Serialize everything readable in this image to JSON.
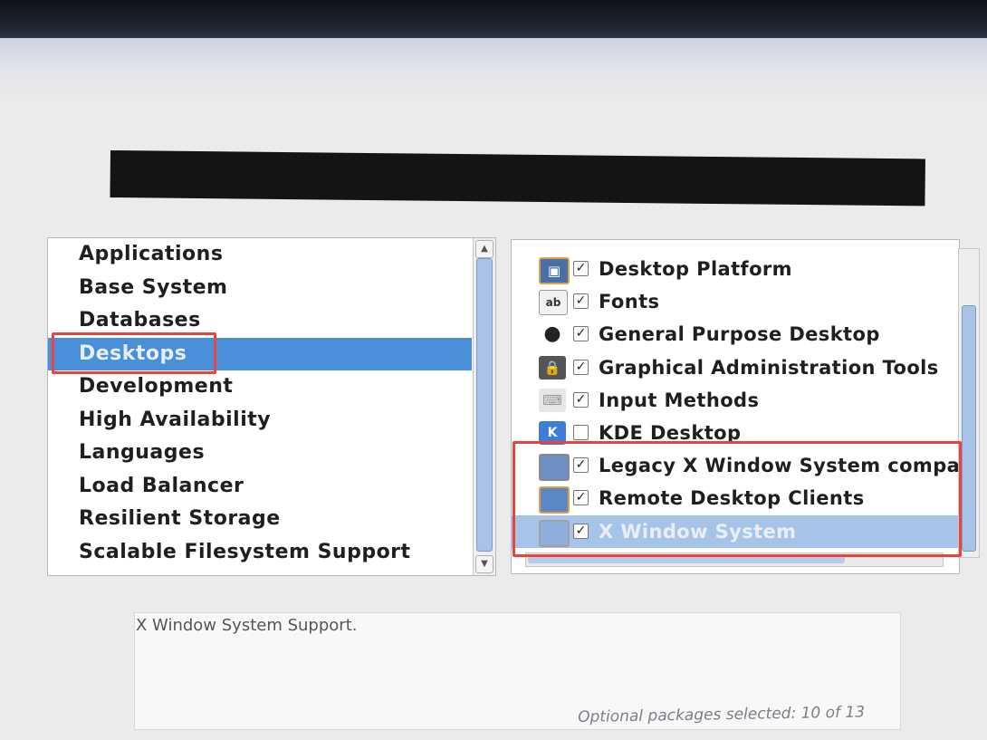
{
  "categories": [
    {
      "label": "Applications"
    },
    {
      "label": "Base System"
    },
    {
      "label": "Databases"
    },
    {
      "label": "Desktops"
    },
    {
      "label": "Development"
    },
    {
      "label": "High Availability"
    },
    {
      "label": "Languages"
    },
    {
      "label": "Load Balancer"
    },
    {
      "label": "Resilient Storage"
    },
    {
      "label": "Scalable Filesystem Support"
    }
  ],
  "selected_category": "Desktops",
  "packages": [
    {
      "label": "Desktop Platform",
      "checked": true,
      "icon": "desktop-platform-icon"
    },
    {
      "label": "Fonts",
      "checked": true,
      "icon": "fonts-icon"
    },
    {
      "label": "General Purpose Desktop",
      "checked": true,
      "icon": "gnome-foot-icon"
    },
    {
      "label": "Graphical Administration Tools",
      "checked": true,
      "icon": "admin-lock-icon"
    },
    {
      "label": "Input Methods",
      "checked": true,
      "icon": "input-methods-icon"
    },
    {
      "label": "KDE Desktop",
      "checked": false,
      "icon": "kde-icon"
    },
    {
      "label": "Legacy X Window System compa",
      "checked": true,
      "icon": "monitor-icon"
    },
    {
      "label": "Remote Desktop Clients",
      "checked": true,
      "icon": "remote-desktop-icon"
    },
    {
      "label": "X Window System",
      "checked": true,
      "icon": "monitor-icon"
    }
  ],
  "selected_package": "X Window System",
  "description": "X Window System Support.",
  "optional_status": "Optional packages selected: 10 of 13",
  "colors": {
    "selection": "#4a90d9",
    "highlight": "#e8433f"
  }
}
